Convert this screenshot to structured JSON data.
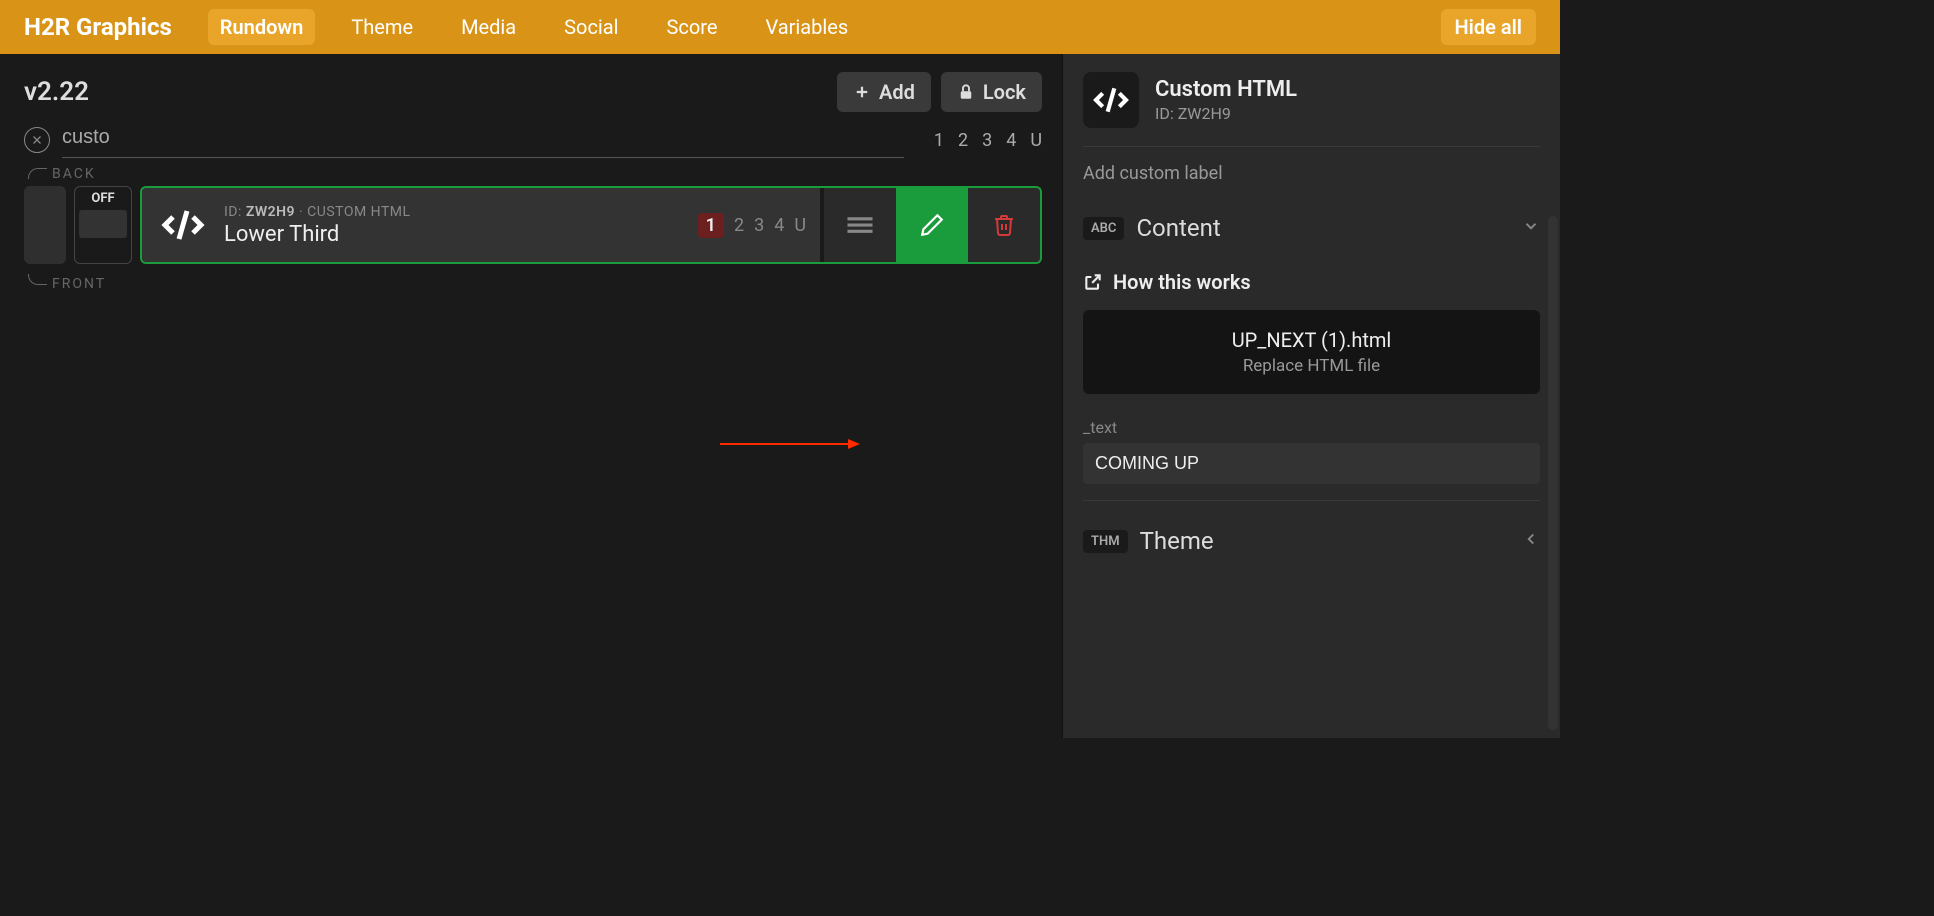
{
  "topbar": {
    "logo": "H2R Graphics",
    "tabs": [
      "Rundown",
      "Theme",
      "Media",
      "Social",
      "Score",
      "Variables"
    ],
    "active_tab": "Rundown",
    "hide_all": "Hide all"
  },
  "left": {
    "version": "v2.22",
    "add_label": "Add",
    "lock_label": "Lock",
    "search_value": "custo",
    "outputs": [
      "1",
      "2",
      "3",
      "4",
      "U"
    ],
    "back_label": "BACK",
    "front_label": "FRONT",
    "item": {
      "off_label": "OFF",
      "id_prefix": "ID:",
      "id": "ZW2H9",
      "type": "CUSTOM HTML",
      "title": "Lower Third",
      "active_output": "1",
      "outputs": [
        "2",
        "3",
        "4",
        "U"
      ]
    }
  },
  "right": {
    "title": "Custom HTML",
    "id_prefix": "ID:",
    "id": "ZW2H9",
    "custom_label_placeholder": "Add custom label",
    "content_badge": "ABC",
    "content_title": "Content",
    "how_this_works": "How this works",
    "file_name": "UP_NEXT (1).html",
    "file_sub": "Replace HTML file",
    "text_field_label": "_text",
    "text_field_value": "COMING UP",
    "theme_badge": "THM",
    "theme_title": "Theme"
  }
}
